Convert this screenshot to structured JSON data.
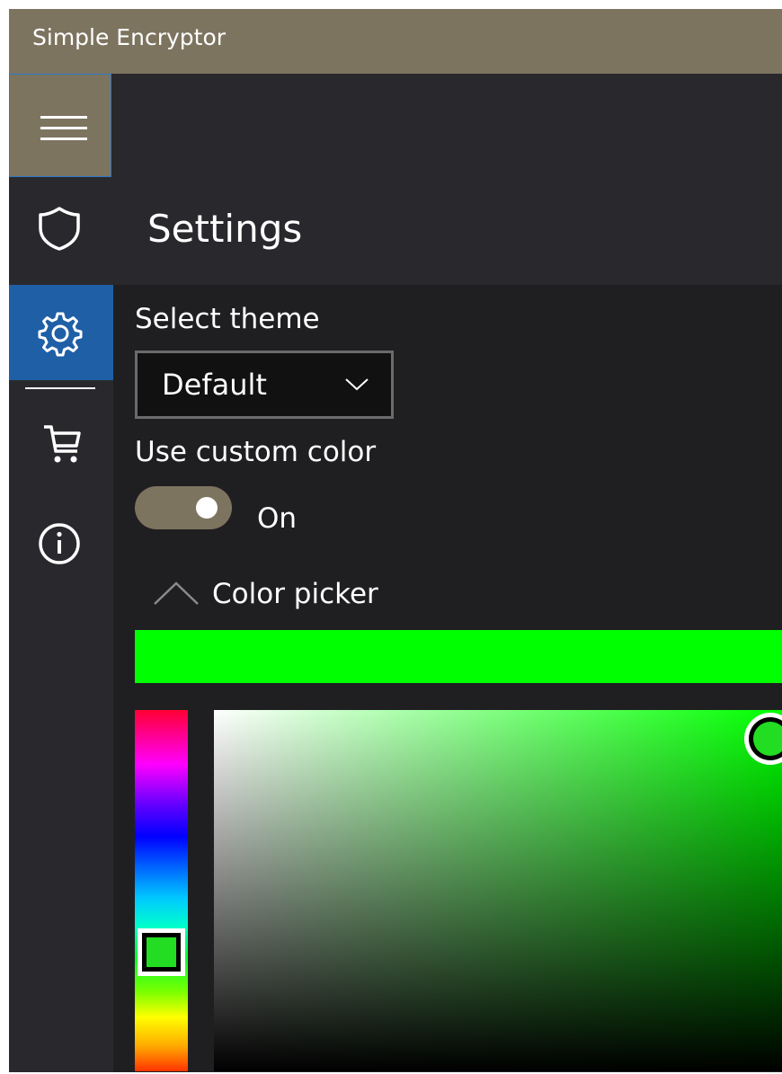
{
  "app": {
    "title": "Simple Encryptor",
    "accent_color": "#7d7460",
    "selection_color": "#1f5fa6"
  },
  "nav": {
    "items": [
      {
        "icon": "shield-icon",
        "selected": false
      },
      {
        "icon": "gear-icon",
        "selected": true
      },
      {
        "icon": "cart-icon",
        "selected": false
      },
      {
        "icon": "info-icon",
        "selected": false
      }
    ]
  },
  "settings": {
    "page_title": "Settings",
    "select_theme_label": "Select theme",
    "theme_value": "Default",
    "custom_color_label": "Use custom color",
    "toggle_state_label": "On",
    "toggle_on": true,
    "color_picker_label": "Color picker",
    "color_picker_expanded": true,
    "selected_color": "#00ff00",
    "hue_thumb_color": "#22dd22",
    "sv_thumb_color": "#22dd22"
  }
}
